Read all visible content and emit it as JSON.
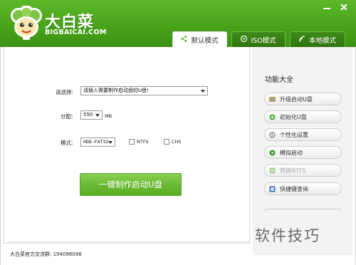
{
  "header": {
    "brand_cn": "大白菜",
    "brand_en": "BIGBAICAI.COM",
    "logo_icon": "cabbage-mascot-icon"
  },
  "window_controls": {
    "minimize_icon": "minimize-icon",
    "close_icon": "close-icon"
  },
  "tabs": [
    {
      "label": "默认模式",
      "icon": "share-icon",
      "active": true
    },
    {
      "label": "ISO模式",
      "icon": "disc-icon",
      "active": false
    },
    {
      "label": "本地模式",
      "icon": "signal-icon",
      "active": false
    }
  ],
  "form": {
    "select_label": "请选择:",
    "select_value": "请插入需要制作启动盘的U盘!",
    "allocate_label": "分配:",
    "allocate_value": "550",
    "allocate_unit": "MB",
    "mode_label": "模式:",
    "mode_value": "HDD-FAT32",
    "ntfs_label": "NTFS",
    "chs_label": "CHS",
    "make_button": "一键制作启动U盘"
  },
  "footer": {
    "qq_group": "大白菜官方交流群: 194096098"
  },
  "functions": {
    "title": "功能大全",
    "items": [
      {
        "label": "升级启动U盘",
        "icon": "upgrade-icon",
        "enabled": true
      },
      {
        "label": "初始化U盘",
        "icon": "init-icon",
        "enabled": true
      },
      {
        "label": "个性化设置",
        "icon": "settings-icon",
        "enabled": true
      },
      {
        "label": "模拟启动",
        "icon": "simulate-icon",
        "enabled": true
      },
      {
        "label": "转换NTFS",
        "icon": "convert-icon",
        "enabled": false
      },
      {
        "label": "快捷键查询",
        "icon": "keyboard-icon",
        "enabled": true
      }
    ]
  },
  "watermark": "软件技巧",
  "colors": {
    "header_green": "#48a31a",
    "button_green": "#6cbb35",
    "panel_gray": "#f3f3f3"
  }
}
